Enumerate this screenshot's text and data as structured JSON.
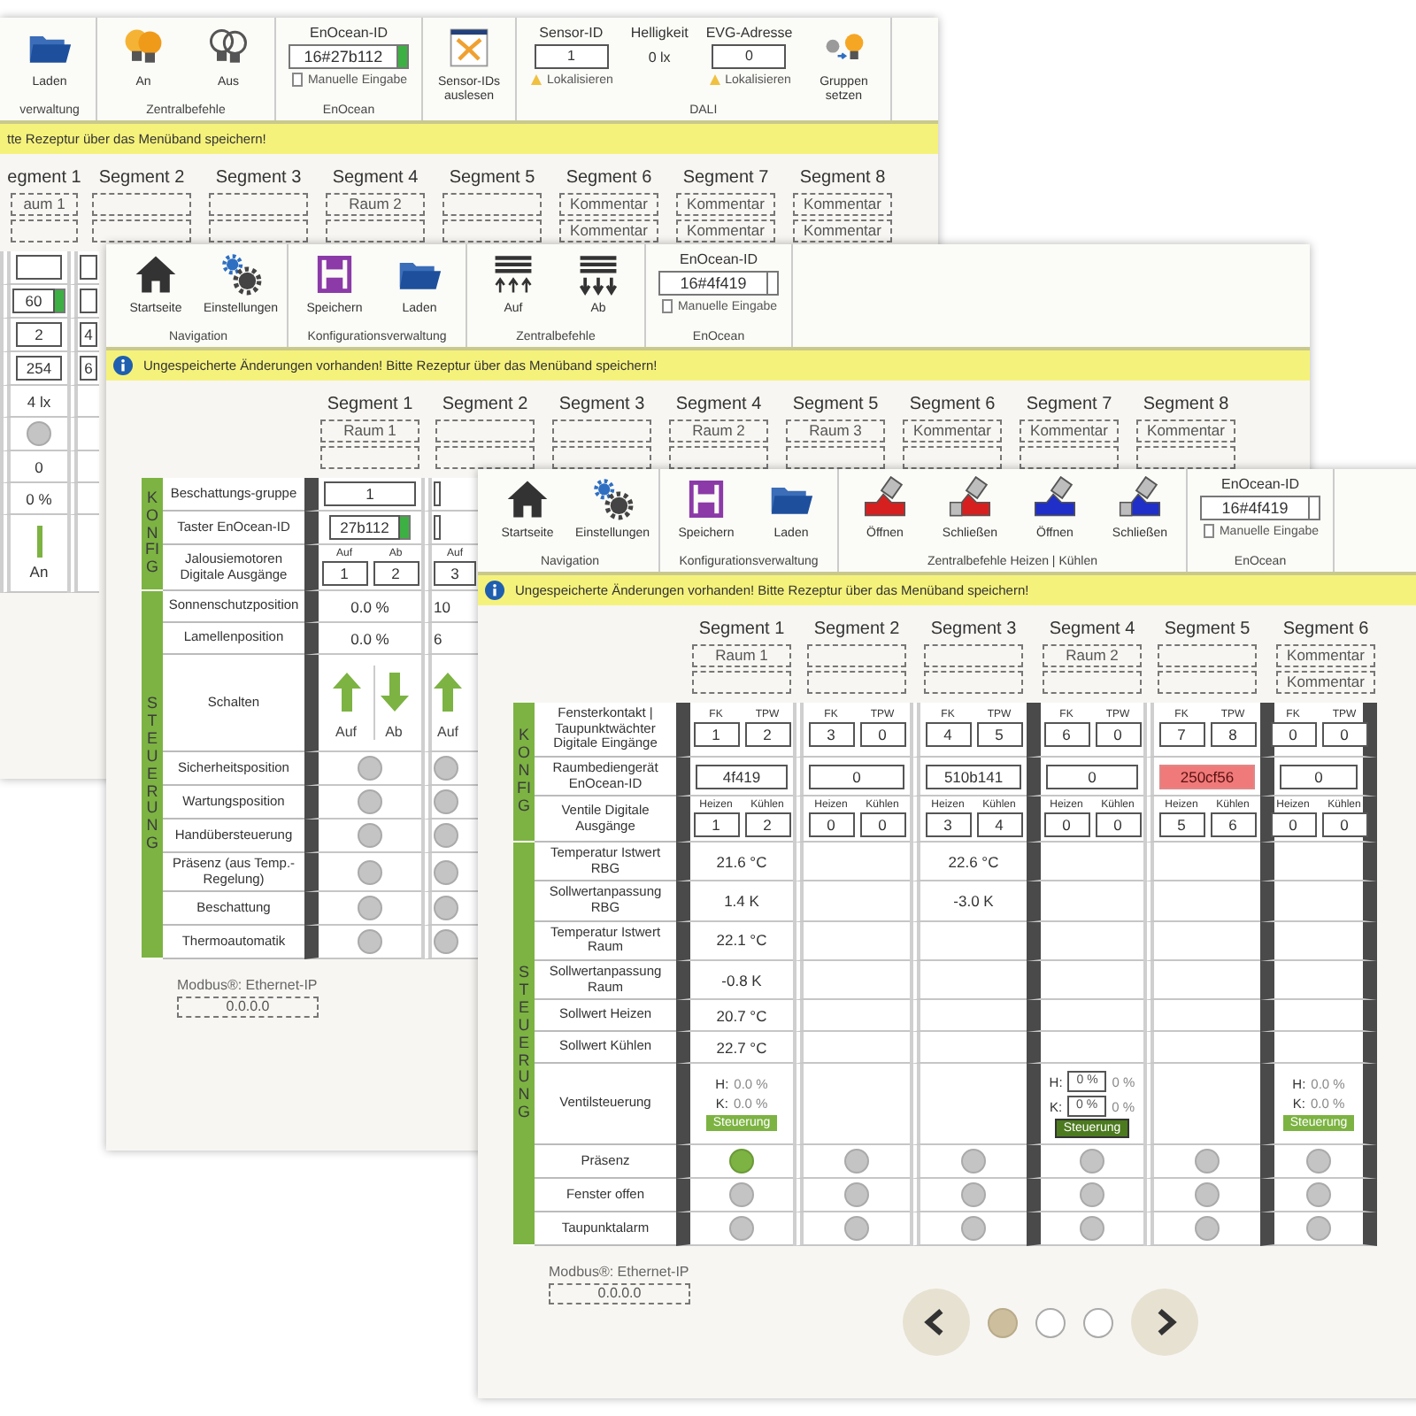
{
  "windows": [
    {
      "toolbar": [
        {
          "label": "verwaltung",
          "items": [
            {
              "kind": "folder",
              "label": "Laden"
            }
          ]
        },
        {
          "label": "Zentralbefehle",
          "items": [
            {
              "kind": "bulbon",
              "label": "An"
            },
            {
              "kind": "bulboff",
              "label": "Aus"
            }
          ]
        },
        {
          "label": "EnOcean",
          "items": [
            {
              "kind": "idfield",
              "label": "EnOcean-ID",
              "value": "16#27b112",
              "indicator": true,
              "link": "Manuelle Eingabe"
            }
          ]
        },
        {
          "items": [
            {
              "kind": "scan",
              "label": "Sensor-IDs auslesen"
            }
          ]
        },
        {
          "label": "DALI",
          "items": [
            {
              "kind": "input",
              "label": "Sensor-ID",
              "value": "1",
              "link": "Lokalisieren"
            },
            {
              "kind": "reading",
              "label": "Helligkeit",
              "value": "0 lx"
            },
            {
              "kind": "input",
              "label": "EVG-Adresse",
              "value": "0",
              "link": "Lokalisieren"
            },
            {
              "kind": "groups",
              "label": "Gruppen setzen"
            }
          ]
        }
      ],
      "banner": {
        "text": "tte Rezeptur über das Menüband speichern!"
      },
      "segments": [
        {
          "title": "egment 1",
          "comment": "aum 1"
        },
        {
          "title": "Segment 2"
        },
        {
          "title": "Segment 3"
        },
        {
          "title": "Segment 4",
          "comment": "Raum 2"
        },
        {
          "title": "Segment 5"
        },
        {
          "title": "Segment 6",
          "comment": "Kommentar",
          "comment_2": "Kommentar"
        },
        {
          "title": "Segment 7",
          "comment": "Kommentar",
          "comment_2": "Kommentar"
        },
        {
          "title": "Segment 8",
          "comment": "Kommentar",
          "comment_2": "Kommentar"
        }
      ],
      "table": {
        "columns": [
          {
            "cells": [
              {
                "kind": "number"
              },
              {
                "kind": "idfield",
                "value": "60",
                "indicator": true
              },
              {
                "kind": "number",
                "value": "2"
              },
              {
                "kind": "number",
                "value": "254"
              },
              {
                "kind": "value",
                "value": "4 lx"
              },
              {
                "kind": "lamp",
                "on": false
              },
              {
                "kind": "value",
                "value": "0"
              },
              {
                "kind": "value",
                "value": "0 %"
              },
              {
                "kind": "switch",
                "label": "An"
              }
            ]
          },
          {
            "partial": true,
            "cells": [
              {
                "kind": "number"
              },
              {
                "kind": "number"
              },
              {
                "kind": "number",
                "value": "4"
              },
              {
                "kind": "number",
                "value": "6"
              },
              {
                "kind": "blank"
              },
              {
                "kind": "blank"
              },
              {
                "kind": "blank"
              },
              {
                "kind": "blank"
              },
              {
                "kind": "blank"
              }
            ]
          }
        ]
      }
    },
    {
      "toolbar": [
        {
          "label": "Navigation",
          "items": [
            {
              "kind": "home",
              "label": "Startseite"
            },
            {
              "kind": "settings",
              "label": "Einstellungen"
            }
          ]
        },
        {
          "label": "Konfigurationsverwaltung",
          "items": [
            {
              "kind": "save",
              "label": "Speichern"
            },
            {
              "kind": "folder",
              "label": "Laden"
            }
          ]
        },
        {
          "label": "Zentralbefehle",
          "items": [
            {
              "kind": "raise",
              "label": "Auf"
            },
            {
              "kind": "lower",
              "label": "Ab"
            }
          ]
        },
        {
          "label": "EnOcean",
          "items": [
            {
              "kind": "idfield",
              "label": "EnOcean-ID",
              "value": "16#4f419",
              "indicator": false,
              "link": "Manuelle Eingabe"
            }
          ]
        }
      ],
      "banner": {
        "info_icon": true,
        "text": "Ungespeicherte Änderungen vorhanden! Bitte Rezeptur über das Menüband speichern!"
      },
      "segments": [
        {
          "title": "Segment 1",
          "comment": "Raum 1"
        },
        {
          "title": "Segment 2"
        },
        {
          "title": "Segment 3"
        },
        {
          "title": "Segment 4",
          "comment": "Raum 2"
        },
        {
          "title": "Segment 5",
          "comment": "Raum 3"
        },
        {
          "title": "Segment 6",
          "comment": "Kommentar"
        },
        {
          "title": "Segment 7",
          "comment": "Kommentar"
        },
        {
          "title": "Segment 8",
          "comment": "Kommentar"
        }
      ],
      "table": {
        "sections": [
          {
            "title": "KONFIG",
            "rows": [
              "Beschattungs-gruppe",
              "Taster EnOcean-ID",
              "Jalousiemotoren Digitale Ausgänge"
            ]
          },
          {
            "title": "STEUERUNG",
            "rows": [
              "Sonnenschutzposition",
              "Lamellenposition",
              "Schalten",
              "Sicherheitsposition",
              "Wartungsposition",
              "Handübersteuerung",
              "Präsenz (aus Temp.-Regelung)",
              "Beschattung",
              "Thermoautomatik"
            ]
          }
        ],
        "columns": [
          {
            "group_start": true,
            "cells": [
              {
                "kind": "number",
                "value": "1"
              },
              {
                "kind": "idfield",
                "value": "27b112",
                "indicator": true
              },
              {
                "kind": "pair",
                "labels": [
                  "Auf",
                  "Ab"
                ],
                "values": [
                  "1",
                  "2"
                ]
              },
              {
                "kind": "value",
                "value": "0.0 %"
              },
              {
                "kind": "value",
                "value": "0.0 %"
              },
              {
                "kind": "arrows",
                "labels": [
                  "Auf",
                  "Ab"
                ]
              },
              {
                "kind": "lamp",
                "on": false
              },
              {
                "kind": "lamp",
                "on": false
              },
              {
                "kind": "lamp",
                "on": false
              },
              {
                "kind": "lamp",
                "on": false
              },
              {
                "kind": "lamp",
                "on": false
              },
              {
                "kind": "lamp",
                "on": false
              }
            ]
          },
          {
            "group_start": false,
            "partial": true,
            "cells": [
              {
                "kind": "number"
              },
              {
                "kind": "number"
              },
              {
                "kind": "pair",
                "labels": [
                  "Auf"
                ],
                "values": [
                  "3"
                ]
              },
              {
                "kind": "value",
                "value": "10"
              },
              {
                "kind": "value",
                "value": "6"
              },
              {
                "kind": "arrows",
                "labels": [
                  "Auf"
                ]
              },
              {
                "kind": "lamp",
                "on": false
              },
              {
                "kind": "lamp",
                "on": false
              },
              {
                "kind": "lamp",
                "on": false
              },
              {
                "kind": "lamp",
                "on": false
              },
              {
                "kind": "lamp",
                "on": false
              },
              {
                "kind": "lamp",
                "on": false
              }
            ]
          }
        ]
      },
      "footer": {
        "label": "Modbus®: Ethernet-IP",
        "value": "0.0.0.0"
      }
    },
    {
      "toolbar": [
        {
          "label": "Navigation",
          "items": [
            {
              "kind": "home",
              "label": "Startseite"
            },
            {
              "kind": "settings",
              "label": "Einstellungen"
            }
          ]
        },
        {
          "label": "Konfigurationsverwaltung",
          "items": [
            {
              "kind": "save",
              "label": "Speichern"
            },
            {
              "kind": "folder",
              "label": "Laden"
            }
          ]
        },
        {
          "label": "Zentralbefehle Heizen | Kühlen",
          "items": [
            {
              "kind": "heatopen",
              "label": "Öffnen"
            },
            {
              "kind": "heatclose",
              "label": "Schließen"
            },
            {
              "kind": "coolopen",
              "label": "Öffnen"
            },
            {
              "kind": "coolclose",
              "label": "Schließen"
            }
          ]
        },
        {
          "label": "EnOcean",
          "items": [
            {
              "kind": "idfield",
              "label": "EnOcean-ID",
              "value": "16#4f419",
              "indicator": false,
              "link": "Manuelle Eingabe"
            }
          ]
        }
      ],
      "banner": {
        "info_icon": true,
        "text": "Ungespeicherte Änderungen vorhanden! Bitte Rezeptur über das Menüband speichern!"
      },
      "segments": [
        {
          "title": "Segment 1",
          "comment": "Raum 1"
        },
        {
          "title": "Segment 2"
        },
        {
          "title": "Segment 3"
        },
        {
          "title": "Segment 4",
          "comment": "Raum 2"
        },
        {
          "title": "Segment 5"
        },
        {
          "title": "Segment 6",
          "comment": "Kommentar",
          "comment_2": "Kommentar"
        }
      ],
      "table": {
        "sections": [
          {
            "title": "KONFIG",
            "rows": [
              "Fensterkontakt | Taupunktwächter Digitale Eingänge",
              "Raumbediengerät EnOcean-ID",
              "Ventile Digitale Ausgänge"
            ]
          },
          {
            "title": "STEUERUNG",
            "rows": [
              "Temperatur Istwert RBG",
              "Sollwertanpassung RBG",
              "Temperatur Istwert Raum",
              "Sollwertanpassung Raum",
              "Sollwert Heizen",
              "Sollwert Kühlen",
              "Ventilsteuerung",
              "Präsenz",
              "Fenster offen",
              "Taupunktalarm"
            ]
          }
        ],
        "columns": [
          {
            "group_start": true,
            "cells": [
              {
                "kind": "pair",
                "labels": [
                  "FK",
                  "TPW"
                ],
                "values": [
                  "1",
                  "2"
                ]
              },
              {
                "kind": "number",
                "value": "4f419",
                "error": false
              },
              {
                "kind": "pair",
                "labels": [
                  "Heizen",
                  "Kühlen"
                ],
                "values": [
                  "1",
                  "2"
                ]
              },
              {
                "kind": "value",
                "value": "21.6 °C"
              },
              {
                "kind": "value",
                "value": "1.4 K"
              },
              {
                "kind": "value",
                "value": "22.1 °C"
              },
              {
                "kind": "value",
                "value": "-0.8 K"
              },
              {
                "kind": "value",
                "value": "20.7 °C"
              },
              {
                "kind": "value",
                "value": "22.7 °C"
              },
              {
                "kind": "valve",
                "rows": [
                  {
                    "label": "H:",
                    "value": "0.0 %"
                  },
                  {
                    "label": "K:",
                    "value": "0.0 %"
                  }
                ],
                "button": "Steuerung",
                "active": false
              },
              {
                "kind": "lamp",
                "on": true
              },
              {
                "kind": "lamp",
                "on": false
              },
              {
                "kind": "lamp",
                "on": false
              }
            ]
          },
          {
            "group_start": false,
            "cells": [
              {
                "kind": "pair",
                "labels": [
                  "FK",
                  "TPW"
                ],
                "values": [
                  "3",
                  "0"
                ]
              },
              {
                "kind": "number",
                "value": "0",
                "error": false
              },
              {
                "kind": "pair",
                "labels": [
                  "Heizen",
                  "Kühlen"
                ],
                "values": [
                  "0",
                  "0"
                ]
              },
              {
                "kind": "blank"
              },
              {
                "kind": "blank"
              },
              {
                "kind": "blank"
              },
              {
                "kind": "blank"
              },
              {
                "kind": "blank"
              },
              {
                "kind": "blank"
              },
              {
                "kind": "blank"
              },
              {
                "kind": "lamp",
                "on": false
              },
              {
                "kind": "lamp",
                "on": false
              },
              {
                "kind": "lamp",
                "on": false
              }
            ]
          },
          {
            "group_start": false,
            "cells": [
              {
                "kind": "pair",
                "labels": [
                  "FK",
                  "TPW"
                ],
                "values": [
                  "4",
                  "5"
                ]
              },
              {
                "kind": "number",
                "value": "510b141",
                "error": false
              },
              {
                "kind": "pair",
                "labels": [
                  "Heizen",
                  "Kühlen"
                ],
                "values": [
                  "3",
                  "4"
                ]
              },
              {
                "kind": "value",
                "value": "22.6 °C"
              },
              {
                "kind": "value",
                "value": "-3.0 K"
              },
              {
                "kind": "blank"
              },
              {
                "kind": "blank"
              },
              {
                "kind": "blank"
              },
              {
                "kind": "blank"
              },
              {
                "kind": "blank"
              },
              {
                "kind": "lamp",
                "on": false
              },
              {
                "kind": "lamp",
                "on": false
              },
              {
                "kind": "lamp",
                "on": false
              }
            ]
          },
          {
            "group_start": true,
            "cells": [
              {
                "kind": "pair",
                "labels": [
                  "FK",
                  "TPW"
                ],
                "values": [
                  "6",
                  "0"
                ]
              },
              {
                "kind": "number",
                "value": "0",
                "error": false
              },
              {
                "kind": "pair",
                "labels": [
                  "Heizen",
                  "Kühlen"
                ],
                "values": [
                  "0",
                  "0"
                ]
              },
              {
                "kind": "blank"
              },
              {
                "kind": "blank"
              },
              {
                "kind": "blank"
              },
              {
                "kind": "blank"
              },
              {
                "kind": "blank"
              },
              {
                "kind": "blank"
              },
              {
                "kind": "valve",
                "rows": [
                  {
                    "label": "H:",
                    "input": "0 %",
                    "value": "0 %"
                  },
                  {
                    "label": "K:",
                    "input": "0 %",
                    "value": "0 %"
                  }
                ],
                "button": "Steuerung",
                "active": true
              },
              {
                "kind": "lamp",
                "on": false
              },
              {
                "kind": "lamp",
                "on": false
              },
              {
                "kind": "lamp",
                "on": false
              }
            ]
          },
          {
            "group_start": false,
            "cells": [
              {
                "kind": "pair",
                "labels": [
                  "FK",
                  "TPW"
                ],
                "values": [
                  "7",
                  "8"
                ]
              },
              {
                "kind": "number",
                "value": "250cf56",
                "error": true
              },
              {
                "kind": "pair",
                "labels": [
                  "Heizen",
                  "Kühlen"
                ],
                "values": [
                  "5",
                  "6"
                ]
              },
              {
                "kind": "blank"
              },
              {
                "kind": "blank"
              },
              {
                "kind": "blank"
              },
              {
                "kind": "blank"
              },
              {
                "kind": "blank"
              },
              {
                "kind": "blank"
              },
              {
                "kind": "blank"
              },
              {
                "kind": "lamp",
                "on": false
              },
              {
                "kind": "lamp",
                "on": false
              },
              {
                "kind": "lamp",
                "on": false
              }
            ]
          },
          {
            "group_start": true,
            "cells": [
              {
                "kind": "pair",
                "labels": [
                  "FK",
                  "TPW"
                ],
                "values": [
                  "0",
                  "0"
                ]
              },
              {
                "kind": "number",
                "value": "0",
                "error": false
              },
              {
                "kind": "pair",
                "labels": [
                  "Heizen",
                  "Kühlen"
                ],
                "values": [
                  "0",
                  "0"
                ]
              },
              {
                "kind": "blank"
              },
              {
                "kind": "blank"
              },
              {
                "kind": "blank"
              },
              {
                "kind": "blank"
              },
              {
                "kind": "blank"
              },
              {
                "kind": "blank"
              },
              {
                "kind": "valve",
                "rows": [
                  {
                    "label": "H:",
                    "value": "0.0 %"
                  },
                  {
                    "label": "K:",
                    "value": "0.0 %"
                  }
                ],
                "button": "Steuerung",
                "active": false
              },
              {
                "kind": "lamp",
                "on": false
              },
              {
                "kind": "lamp",
                "on": false
              },
              {
                "kind": "lamp",
                "on": false
              }
            ]
          }
        ]
      },
      "footer": {
        "label": "Modbus®: Ethernet-IP",
        "value": "0.0.0.0"
      },
      "pager": {
        "dots": [
          {
            "selected": true
          },
          {
            "selected": false
          },
          {
            "selected": false
          }
        ]
      }
    }
  ]
}
